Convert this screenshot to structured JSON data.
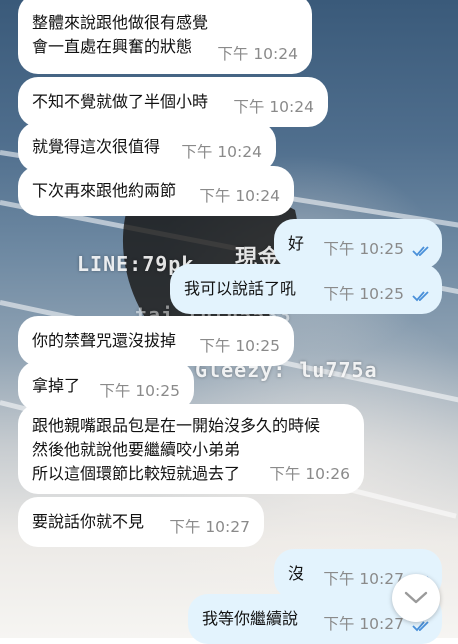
{
  "watermarks": {
    "line": "LINE:79pk",
    "kanji": "現金",
    "faded": "tai lulu5533",
    "gleezy": "Gleezy: lu775a"
  },
  "colors": {
    "incoming_bubble": "#ffffff",
    "outgoing_bubble": "#e3f3fd",
    "read_check": "#4a90d9",
    "timestamp": "#8a8a8a"
  },
  "messages": [
    {
      "side": "in",
      "text": "整體來說跟他做很有感覺\n會一直處在興奮的狀態",
      "time": "下午 10:24"
    },
    {
      "side": "in",
      "text": "不知不覺就做了半個小時",
      "time": "下午 10:24"
    },
    {
      "side": "in",
      "text": "就覺得這次很值得",
      "time": "下午 10:24"
    },
    {
      "side": "in",
      "text": "下次再來跟他約兩節",
      "time": "下午 10:24"
    },
    {
      "side": "out",
      "text": "好",
      "time": "下午 10:25",
      "status_icon": "double-check-icon"
    },
    {
      "side": "out",
      "text": "我可以說話了吼",
      "time": "下午 10:25",
      "status_icon": "double-check-icon"
    },
    {
      "side": "in",
      "text": "你的禁聲咒還沒拔掉",
      "time": "下午 10:25"
    },
    {
      "side": "in",
      "text": "拿掉了",
      "time": "下午 10:25"
    },
    {
      "side": "in",
      "text": "跟他親嘴跟品包是在一開始沒多久的時候\n然後他就說他要繼續咬小弟弟\n所以這個環節比較短就過去了",
      "time": "下午 10:26"
    },
    {
      "side": "in",
      "text": "要說話你就不見",
      "time": "下午 10:27"
    },
    {
      "side": "out",
      "text": "沒",
      "time": "下午 10:27",
      "status_icon": "double-check-icon"
    },
    {
      "side": "out",
      "text": "我等你繼續說",
      "time": "下午 10:27",
      "status_icon": "double-check-icon"
    }
  ],
  "scroll_button": {
    "icon": "chevron-down-icon"
  }
}
